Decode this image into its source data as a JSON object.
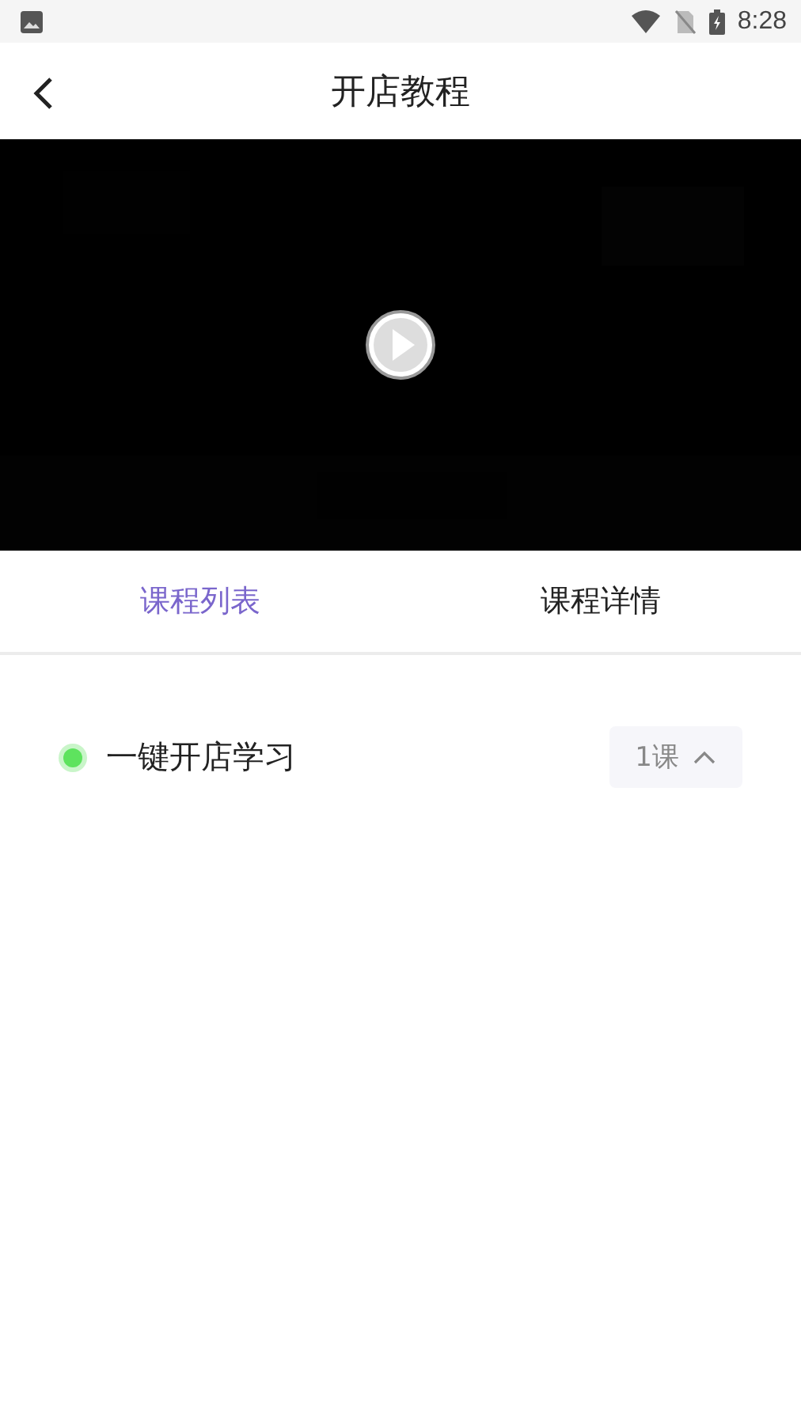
{
  "status_bar": {
    "time": "8:28"
  },
  "header": {
    "title": "开店教程"
  },
  "tabs": [
    {
      "label": "课程列表",
      "selected": true
    },
    {
      "label": "课程详情",
      "selected": false
    }
  ],
  "chapters": [
    {
      "title": "一键开店学习",
      "count": "1课",
      "expanded": true
    }
  ]
}
